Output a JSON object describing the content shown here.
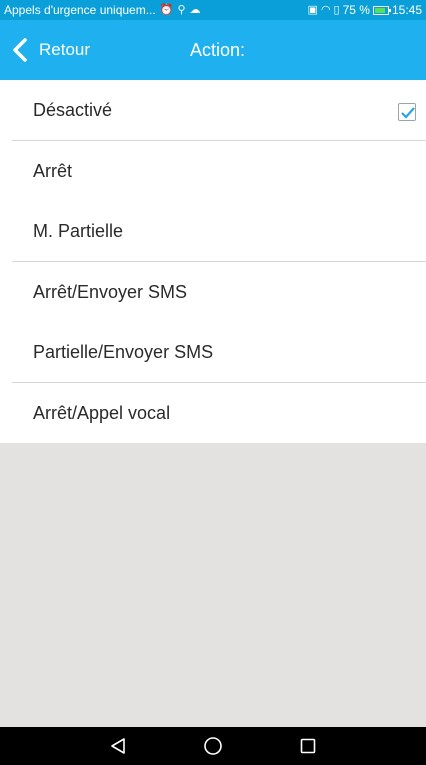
{
  "status_bar": {
    "notification_text": "Appels d'urgence uniquem...",
    "battery_percent": "75 %",
    "time": "15:45",
    "icons": [
      "alarm-icon",
      "usb-icon",
      "cloud-icon",
      "nfc-icon",
      "wifi-icon",
      "vibrate-icon",
      "battery-icon"
    ]
  },
  "header": {
    "back_label": "Retour",
    "title": "Action:"
  },
  "options": [
    {
      "label": "Désactivé",
      "checked": true
    },
    {
      "label": "Arrêt",
      "checked": false
    },
    {
      "label": "M. Partielle",
      "checked": false
    },
    {
      "label": "Arrêt/Envoyer SMS",
      "checked": false
    },
    {
      "label": "Partielle/Envoyer SMS",
      "checked": false
    },
    {
      "label": "Arrêt/Appel vocal",
      "checked": false
    }
  ],
  "colors": {
    "header_bg": "#1fb1ef",
    "status_bg": "#0a9fd8",
    "check_accent": "#2aa3e0",
    "empty_area": "#e3e2e0"
  },
  "nav_bar": {
    "icons": [
      "back-triangle-icon",
      "home-circle-icon",
      "recents-square-icon"
    ]
  }
}
